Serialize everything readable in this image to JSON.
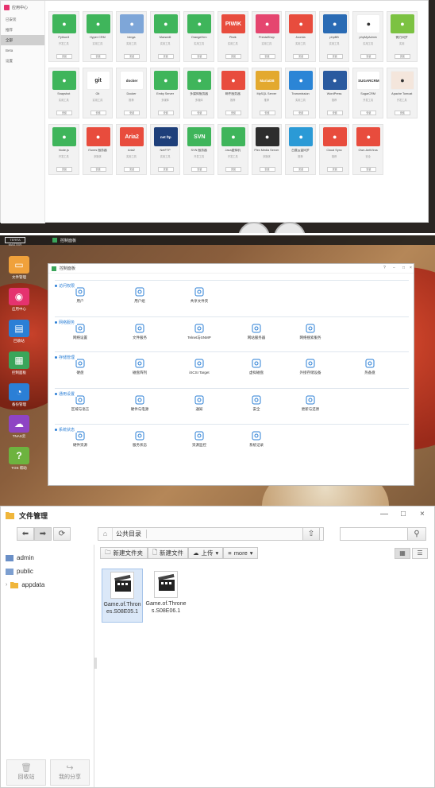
{
  "app_center": {
    "title": "应用中心",
    "nav": [
      "已安装",
      "推荐",
      "全部",
      "Beta",
      "设置"
    ],
    "active_nav": 2,
    "apps": [
      {
        "name": "Python3",
        "sub": "开发工具",
        "btn": "安装",
        "color": "#3fb55b",
        "icon": "python-icon"
      },
      {
        "name": "Hyper CRM",
        "sub": "实用工具",
        "btn": "安装",
        "color": "#3fb55b",
        "icon": "cloud-icon"
      },
      {
        "name": "Icinga",
        "sub": "实用工具",
        "btn": "安装",
        "color": "#7ea6d8",
        "icon": "user-icon"
      },
      {
        "name": "Marsedit",
        "sub": "实用工具",
        "btn": "安装",
        "color": "#3fb55b",
        "icon": "leaf-icon"
      },
      {
        "name": "OrangeHrm",
        "sub": "实用工具",
        "btn": "安装",
        "color": "#3fb55b",
        "icon": "orange-icon"
      },
      {
        "name": "Piwik",
        "sub": "实用工具",
        "btn": "安装",
        "color": "#e84c3d",
        "icon": "piwik-icon",
        "label": "PIWIK"
      },
      {
        "name": "PrestaShop",
        "sub": "实用工具",
        "btn": "安装",
        "color": "#e5466f",
        "icon": "shop-icon"
      },
      {
        "name": "Joomla",
        "sub": "实用工具",
        "btn": "安装",
        "color": "#e84c3d",
        "icon": "joomla-icon"
      },
      {
        "name": "phpBB",
        "sub": "实用工具",
        "btn": "安装",
        "color": "#2a6bb4",
        "icon": "phpbb-icon"
      },
      {
        "name": "phpMyAdmin",
        "sub": "实用工具",
        "btn": "安装",
        "color": "#ffffff",
        "icon": "phpmyadmin-icon"
      },
      {
        "name": "微力同步",
        "sub": "实用",
        "btn": "安装",
        "color": "#7cc242",
        "icon": "sync-icon"
      },
      {
        "name": "Snapshot",
        "sub": "实用工具",
        "btn": "安装",
        "color": "#3fb55b",
        "icon": "camera-icon"
      },
      {
        "name": "Git",
        "sub": "实用工具",
        "btn": "安装",
        "color": "#ffffff",
        "icon": "git-icon",
        "label": "git"
      },
      {
        "name": "Docker",
        "sub": "推荐",
        "btn": "安装",
        "color": "#ffffff",
        "icon": "docker-icon",
        "label": "docker"
      },
      {
        "name": "Emby Server",
        "sub": "多媒体",
        "btn": "安装",
        "color": "#3fb55b",
        "icon": "emby-icon"
      },
      {
        "name": "多媒体服务器",
        "sub": "多媒体",
        "btn": "安装",
        "color": "#3fb55b",
        "icon": "play-icon"
      },
      {
        "name": "邮件服务器",
        "sub": "推荐",
        "btn": "安装",
        "color": "#e84c3d",
        "icon": "mail-icon"
      },
      {
        "name": "MySQL Server",
        "sub": "推荐",
        "btn": "安装",
        "color": "#e3a92f",
        "icon": "mariadb-icon",
        "label": "MariaDB"
      },
      {
        "name": "Transmission",
        "sub": "实用工具",
        "btn": "安装",
        "color": "#2b85d6",
        "icon": "download-icon"
      },
      {
        "name": "WordPress",
        "sub": "推荐",
        "btn": "安装",
        "color": "#2a5a9f",
        "icon": "wordpress-icon"
      },
      {
        "name": "SugarCRM",
        "sub": "开发工具",
        "btn": "安装",
        "color": "#ffffff",
        "icon": "sugarcrm-icon",
        "label": "SUGARCRM"
      },
      {
        "name": "Apache Tomcat",
        "sub": "开发工具",
        "btn": "安装",
        "color": "#f4e6dc",
        "icon": "tomcat-icon"
      },
      {
        "name": "Node.js",
        "sub": "开发工具",
        "btn": "安装",
        "color": "#3fb55b",
        "icon": "nodejs-icon"
      },
      {
        "name": "iTunes 服务器",
        "sub": "多媒体",
        "btn": "安装",
        "color": "#e84c3d",
        "icon": "music-icon"
      },
      {
        "name": "Aria2",
        "sub": "实用工具",
        "btn": "安装",
        "color": "#e84c3d",
        "icon": "aria2-icon",
        "label": "Aria2"
      },
      {
        "name": "NetFTP",
        "sub": "实用工具",
        "btn": "安装",
        "color": "#1e3f7a",
        "icon": "ftp-icon",
        "label": "net ftp"
      },
      {
        "name": "SVN 服务器",
        "sub": "开发工具",
        "btn": "安装",
        "color": "#3fb55b",
        "icon": "svn-icon",
        "label": "SVN"
      },
      {
        "name": "Java虚拟机",
        "sub": "开发工具",
        "btn": "安装",
        "color": "#3fb55b",
        "icon": "java-icon"
      },
      {
        "name": "Plex Media Server",
        "sub": "多媒体",
        "btn": "安装",
        "color": "#2d2d2d",
        "icon": "plex-icon"
      },
      {
        "name": "百度云盘同步",
        "sub": "推荐",
        "btn": "安装",
        "color": "#2b9ad6",
        "icon": "baidu-icon"
      },
      {
        "name": "Cloud Sync",
        "sub": "推荐",
        "btn": "安装",
        "color": "#e84c3d",
        "icon": "cloudsync-icon"
      },
      {
        "name": "Own-AntiVirus",
        "sub": "安全",
        "btn": "安装",
        "color": "#e84c3d",
        "icon": "antivirus-icon"
      }
    ]
  },
  "desktop": {
    "topbar_logo": "TERRA MASTER",
    "topbar_app": "控制面板",
    "dock": [
      {
        "label": "文件管理",
        "color": "#f0a13b",
        "icon": "folder-icon"
      },
      {
        "label": "应用中心",
        "color": "#e5336f",
        "icon": "bag-icon"
      },
      {
        "label": "回收站",
        "color": "#2b7fd6",
        "icon": "trash-icon"
      },
      {
        "label": "控制面板",
        "color": "#3aa55a",
        "icon": "control-panel-icon"
      },
      {
        "label": "备份管理",
        "color": "#2b7fd6",
        "icon": "backup-icon"
      },
      {
        "label": "TNAS云",
        "color": "#8e44c4",
        "icon": "cloud-icon"
      },
      {
        "label": "TOS 帮助",
        "color": "#6db33f",
        "icon": "help-icon"
      }
    ],
    "control_panel": {
      "title": "控制面板",
      "window_controls": [
        "?",
        "−",
        "□",
        "×"
      ],
      "sections": [
        {
          "title": "访问权限",
          "items": [
            {
              "label": "用户",
              "icon": "user-icon"
            },
            {
              "label": "用户组",
              "icon": "group-icon"
            },
            {
              "label": "共享文件夹",
              "icon": "shared-folder-icon"
            }
          ]
        },
        {
          "title": "网络服务",
          "items": [
            {
              "label": "网络设置",
              "icon": "network-icon"
            },
            {
              "label": "文件服务",
              "icon": "file-service-icon"
            },
            {
              "label": "Telnet与SNMP",
              "icon": "telnet-icon"
            },
            {
              "label": "网站服务器",
              "icon": "web-server-icon"
            },
            {
              "label": "网络搜索服务",
              "icon": "network-search-icon"
            }
          ]
        },
        {
          "title": "存储管理",
          "items": [
            {
              "label": "硬盘",
              "icon": "disk-icon"
            },
            {
              "label": "磁盘阵列",
              "icon": "raid-icon"
            },
            {
              "label": "iSCSI Target",
              "icon": "iscsi-icon"
            },
            {
              "label": "虚拟磁盘",
              "icon": "virtual-disk-icon"
            },
            {
              "label": "外接存储设备",
              "icon": "external-storage-icon"
            },
            {
              "label": "热备盘",
              "icon": "hot-spare-icon"
            }
          ]
        },
        {
          "title": "通用设置",
          "items": [
            {
              "label": "区域与语言",
              "icon": "globe-icon"
            },
            {
              "label": "硬件与电源",
              "icon": "wrench-icon"
            },
            {
              "label": "通知",
              "icon": "notification-icon"
            },
            {
              "label": "安全",
              "icon": "lock-icon"
            },
            {
              "label": "更新与还原",
              "icon": "update-icon"
            }
          ]
        },
        {
          "title": "系统状态",
          "items": [
            {
              "label": "硬件资源",
              "icon": "hardware-resource-icon"
            },
            {
              "label": "服务状态",
              "icon": "service-status-icon"
            },
            {
              "label": "资源监控",
              "icon": "resource-monitor-icon"
            },
            {
              "label": "系统记录",
              "icon": "system-log-icon"
            }
          ]
        }
      ]
    }
  },
  "file_manager": {
    "title": "文件管理",
    "window_controls": [
      "—",
      "□",
      "×"
    ],
    "path": "公共目录",
    "search_placeholder": "",
    "tree": [
      {
        "label": "admin",
        "icon": "user-folder-icon"
      },
      {
        "label": "public",
        "icon": "public-folder-icon"
      },
      {
        "label": "appdata",
        "icon": "folder-icon"
      }
    ],
    "actions": [
      "新建文件夹",
      "新建文件",
      "上传",
      "more"
    ],
    "files": [
      {
        "name": "Game.of.Thrones.S08E05.1",
        "selected": true
      },
      {
        "name": "Game.of.Thrones.S08E06.1",
        "selected": false
      }
    ],
    "bottom_buttons": [
      "回收站",
      "我的分享"
    ]
  }
}
